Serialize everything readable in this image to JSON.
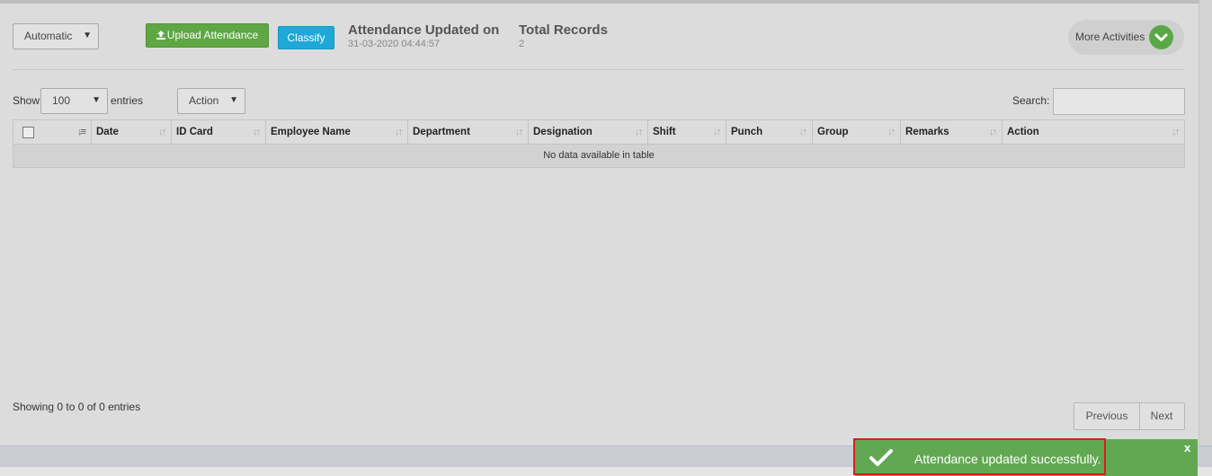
{
  "toolbar": {
    "mode_select": "Automatic",
    "upload_label": "Upload Attendance",
    "classify_label": "Classify"
  },
  "info": {
    "updated_title": "Attendance Updated on",
    "updated_value": "31-03-2020 04:44:57",
    "records_title": "Total Records",
    "records_value": "2"
  },
  "more_activities": "More Activities",
  "table_controls": {
    "show_label": "Show",
    "page_size": "100",
    "entries_label": "entries",
    "action_select": "Action",
    "search_label": "Search:",
    "search_value": ""
  },
  "table": {
    "columns": [
      "",
      "Date",
      "ID Card",
      "Employee Name",
      "Department",
      "Designation",
      "Shift",
      "Punch",
      "Group",
      "Remarks",
      "Action"
    ],
    "empty_message": "No data available in table"
  },
  "footer": {
    "showing": "Showing 0 to 0 of 0 entries",
    "previous": "Previous",
    "next": "Next"
  },
  "toast": {
    "message": "Attendance updated successfully.",
    "close": "x"
  },
  "colors": {
    "upload": "#5fa744",
    "classify": "#1da8d8",
    "toast": "#62a852",
    "highlight": "#d81e1e"
  }
}
